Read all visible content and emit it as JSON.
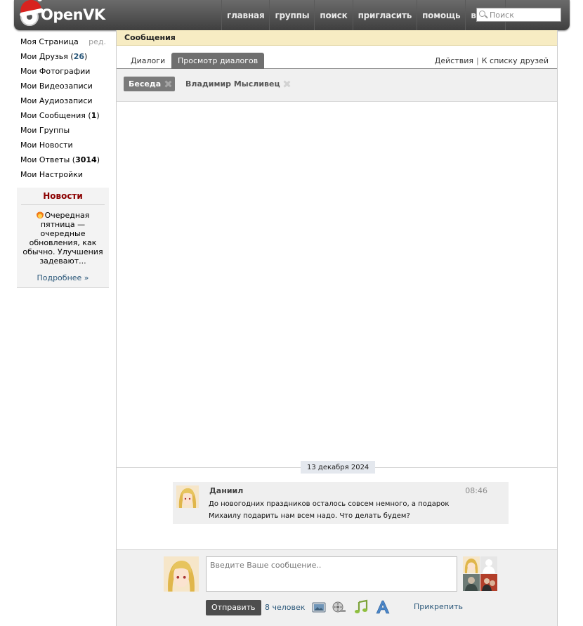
{
  "header": {
    "logo_text": "OpenVK",
    "nav": [
      "главная",
      "группы",
      "поиск",
      "пригласить",
      "помощь",
      "выйти"
    ],
    "search_placeholder": "Поиск"
  },
  "sidebar": {
    "items": [
      {
        "label": "Моя Страница",
        "extra": "ред."
      },
      {
        "label": "Мои Друзья",
        "count": "26"
      },
      {
        "label": "Мои Фотографии"
      },
      {
        "label": "Мои Видеозаписи"
      },
      {
        "label": "Мои Аудиозаписи"
      },
      {
        "label": "Мои Сообщения",
        "count": "1"
      },
      {
        "label": "Мои Группы"
      },
      {
        "label": "Мои Новости"
      },
      {
        "label": "Мои Ответы",
        "count": "3014"
      },
      {
        "label": "Мои Настройки"
      }
    ],
    "news": {
      "title": "Новости",
      "text": "Очередная пятница — очередные обновления, как обычно. Улучшения задевают...",
      "more": "Подробнее »"
    }
  },
  "main": {
    "title": "Сообщения",
    "tabs": [
      "Диалоги",
      "Просмотр диалогов"
    ],
    "actions": [
      "Действия",
      "К списку друзей"
    ],
    "chips": [
      "Беседа",
      "Владимир Мысливец"
    ],
    "date": "13 декабря 2024",
    "message": {
      "author": "Даниил",
      "time": "08:46",
      "text": "До новогодних праздников осталось совсем немного, а подарок Михаилу подарить нам всем надо. Что делать будем?"
    },
    "composer": {
      "placeholder": "Введите Ваше сообщение..",
      "send": "Отправить",
      "people": "8 человек",
      "attach": "Прикрепить"
    }
  },
  "colors": {
    "header_bg": "#4d4d4d",
    "link_blue": "#2b587a",
    "news_title": "#8b0000",
    "page_title_bg": "#f7ecc3"
  }
}
